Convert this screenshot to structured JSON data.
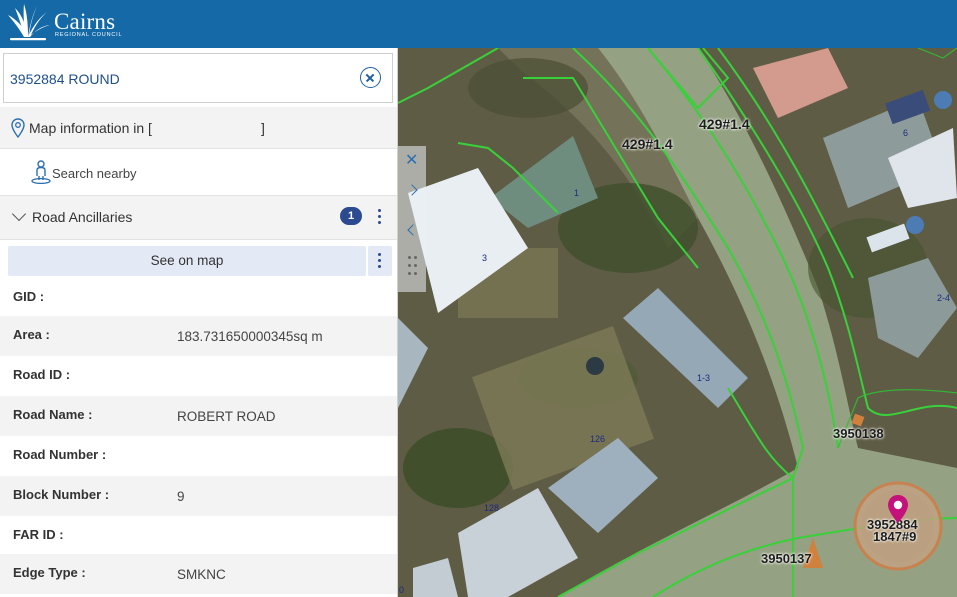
{
  "header": {
    "logo_text": "Cairns",
    "logo_subtext": "REGIONAL COUNCIL"
  },
  "search": {
    "value": "3952884 ROUND"
  },
  "map_info": {
    "label": "Map information in [",
    "close_bracket": "]"
  },
  "nearby": {
    "label": "Search nearby"
  },
  "section": {
    "label": "Road Ancillaries",
    "count": "1"
  },
  "see_map": {
    "label": "See on map"
  },
  "attributes": [
    {
      "label": "GID :",
      "value": ""
    },
    {
      "label": "Area :",
      "value": "183.731650000345sq m"
    },
    {
      "label": "Road ID :",
      "value": ""
    },
    {
      "label": "Road Name :",
      "value": "ROBERT ROAD"
    },
    {
      "label": "Road Number :",
      "value": ""
    },
    {
      "label": "Block Number :",
      "value": "9"
    },
    {
      "label": "FAR ID :",
      "value": ""
    },
    {
      "label": "Edge Type :",
      "value": "SMKNC"
    }
  ],
  "map": {
    "labels": {
      "road_a": "429#1.4",
      "road_b": "429#1.4",
      "parcel_1": "3950138",
      "parcel_2": "3950137",
      "parcel_3": "3952884",
      "parcel_4": "1847#9",
      "lot_1": "1",
      "lot_3": "3",
      "lot_6": "6",
      "lot_2_4": "2-4",
      "lot_1_3": "1-3",
      "lot_126": "126",
      "lot_128": "128",
      "lot_0": "0"
    },
    "colors": {
      "parcel_line": "#38d13a",
      "selection": "#c8824f",
      "pin": "#c4127a"
    }
  }
}
